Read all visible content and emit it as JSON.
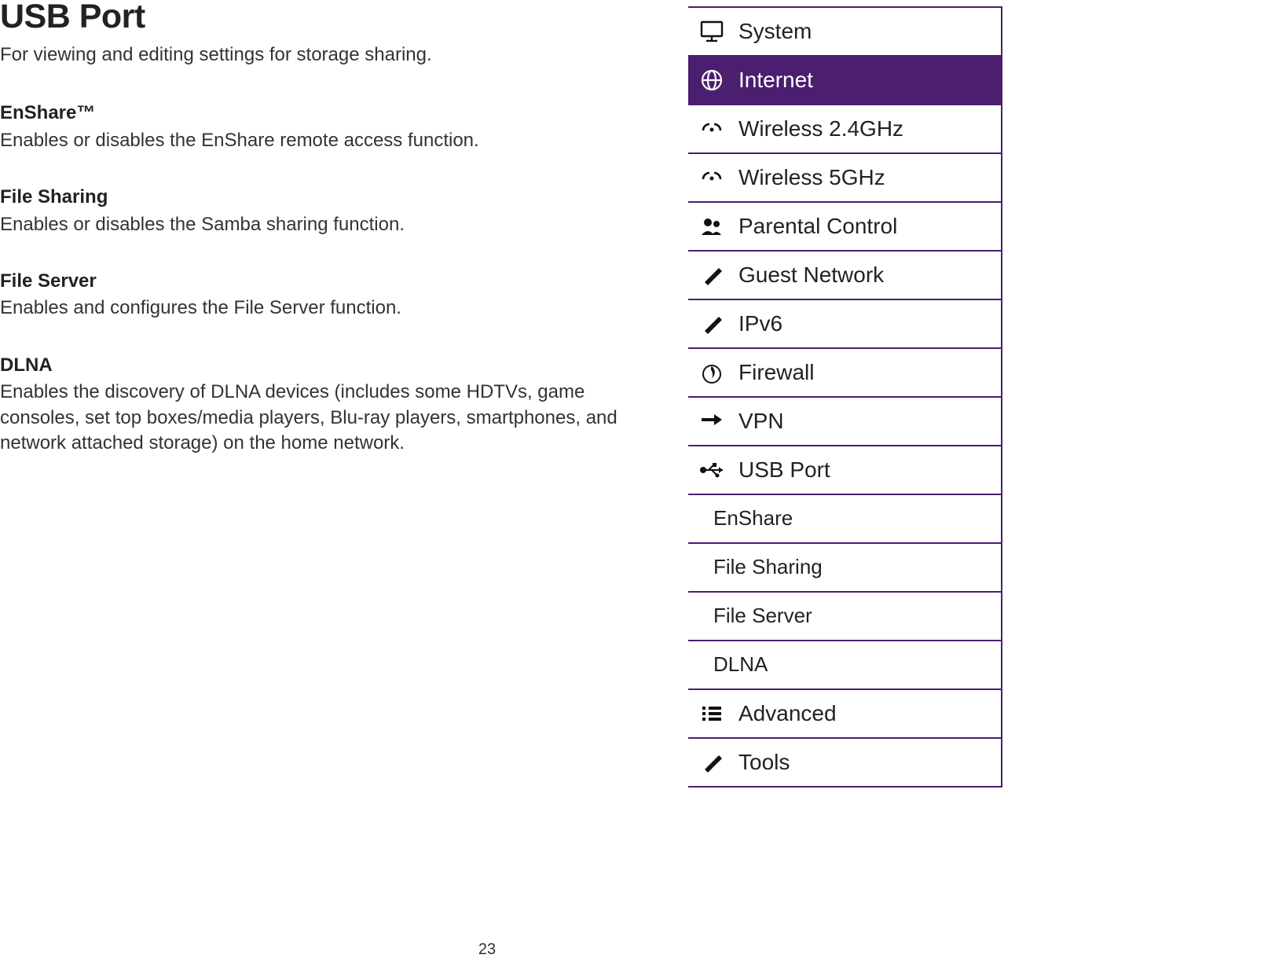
{
  "article": {
    "title": "USB Port",
    "subtitle": "For viewing and editing settings for storage sharing.",
    "sections": [
      {
        "label": "EnShare™",
        "desc": "Enables or disables the EnShare remote access function."
      },
      {
        "label": "File Sharing",
        "desc": "Enables or disables the Samba sharing function."
      },
      {
        "label": "File Server",
        "desc": "Enables and configures the File Server function."
      },
      {
        "label": "DLNA",
        "desc": "Enables the discovery of DLNA devices (includes some HDTVs, game consoles, set top boxes/media players, Blu-ray players, smartphones, and network attached storage) on the home network."
      }
    ]
  },
  "page_number": "23",
  "menu": {
    "items": [
      {
        "label": "System",
        "icon": "monitor-icon"
      },
      {
        "label": "Internet",
        "icon": "globe-icon",
        "active": true
      },
      {
        "label": "Wireless 2.4GHz",
        "icon": "wifi-icon"
      },
      {
        "label": "Wireless 5GHz",
        "icon": "wifi-icon"
      },
      {
        "label": "Parental Control",
        "icon": "users-icon"
      },
      {
        "label": "Guest Network",
        "icon": "tools-icon"
      },
      {
        "label": "IPv6",
        "icon": "tools-icon"
      },
      {
        "label": "Firewall",
        "icon": "flame-icon"
      },
      {
        "label": "VPN",
        "icon": "arrows-icon"
      },
      {
        "label": "USB Port",
        "icon": "usb-icon",
        "sub": [
          {
            "label": "EnShare"
          },
          {
            "label": "File Sharing"
          },
          {
            "label": "File Server"
          },
          {
            "label": "DLNA"
          }
        ]
      },
      {
        "label": "Advanced",
        "icon": "list-icon"
      },
      {
        "label": "Tools",
        "icon": "tools-icon"
      }
    ]
  }
}
